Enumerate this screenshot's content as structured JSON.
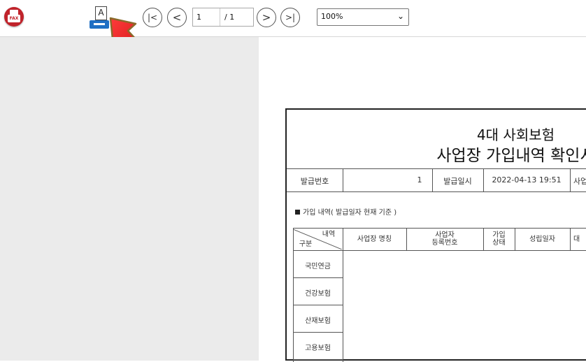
{
  "toolbar": {
    "fax_label": "FAX",
    "print_glyph": "A",
    "nav": {
      "first_icon": "|<",
      "prev_icon": "<",
      "next_icon": ">",
      "last_icon": ">|"
    },
    "page_current": "1",
    "page_total": "/ 1",
    "zoom_value": "100%",
    "zoom_chevron": "⌄"
  },
  "document": {
    "title_line1": "4대 사회보험",
    "title_line2": "사업장 가입내역 확인서",
    "info_row": {
      "issue_no_label": "발급번호",
      "issue_no_value": "1",
      "issue_date_label": "발급일시",
      "issue_date_value": "2022-04-13 19:51",
      "trailing": "사업"
    },
    "section_title": "가입 내역( 발급일자 현재 기준 )",
    "table": {
      "corner_top": "내역",
      "corner_bottom": "구분",
      "headers": [
        "사업장 명칭",
        "사업자\n등록번호",
        "가입\n상태",
        "성립일자",
        "대"
      ],
      "rows": [
        "국민연금",
        "건강보험",
        "산재보험",
        "고용보험"
      ]
    }
  },
  "colors": {
    "fax_red": "#c0232b",
    "print_blue": "#1f6fc4",
    "arrow_red": "#e01e1e",
    "viewer_gray": "#ebebeb"
  }
}
